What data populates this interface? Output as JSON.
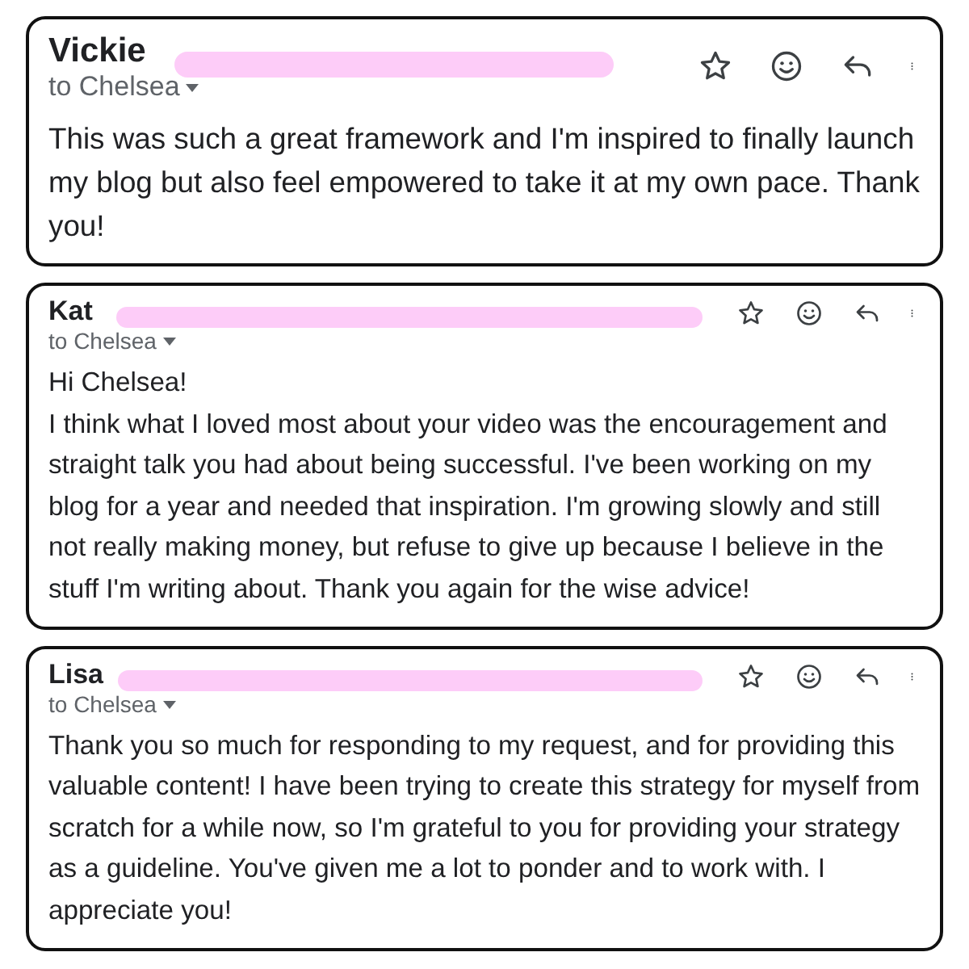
{
  "emails": [
    {
      "sender": "Vickie",
      "recipient": "to Chelsea",
      "paragraphs": [
        "This was such a great framework and I'm inspired to finally launch my blog but also feel empowered to take it at my own pace. Thank you!"
      ]
    },
    {
      "sender": "Kat",
      "recipient": "to Chelsea",
      "paragraphs": [
        "Hi Chelsea!",
        "I think what I loved most about your video was the encouragement and straight talk you had about being successful. I've been working on my blog for a year and needed that inspiration. I'm growing slowly and still not really making money, but refuse to give up because I believe in the stuff I'm writing about. Thank you again for the wise advice!"
      ]
    },
    {
      "sender": "Lisa",
      "recipient": "to Chelsea",
      "paragraphs": [
        "Thank you so much for responding to my request, and for providing this valuable content! I have been trying to create this strategy for myself from scratch for a while now, so I'm grateful to you for providing your strategy as a guideline. You've given me a lot to ponder and to work with. I appreciate you!"
      ]
    }
  ]
}
